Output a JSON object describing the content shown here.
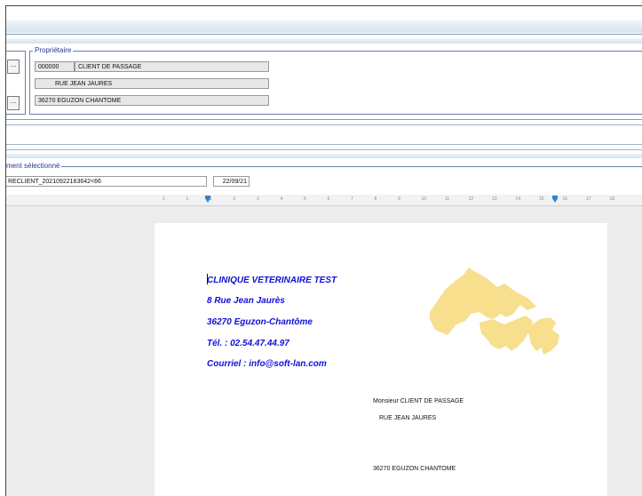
{
  "owner_section": {
    "title": "Propriétaire",
    "code": "000000",
    "name": "CLIENT DE PASSAGE",
    "street": "RUE JEAN JAURES",
    "city": "36270 EGUZON CHANTOME"
  },
  "buttons": {
    "ellipsis": "..."
  },
  "document_section": {
    "title": "ment sélectionné",
    "filename": "RECLIENT_20210922163642<66",
    "date": "22/09/21"
  },
  "ruler": {
    "ticks": [
      "2",
      "1",
      "1",
      "2",
      "3",
      "4",
      "5",
      "6",
      "7",
      "8",
      "9",
      "10",
      "11",
      "12",
      "13",
      "14",
      "15",
      "16",
      "17",
      "18"
    ]
  },
  "letter": {
    "clinic_name": "CLINIQUE VETERINAIRE TEST",
    "clinic_street": "8 Rue Jean Jaurès",
    "clinic_city": "36270 Eguzon-Chantôme",
    "clinic_phone": "Tél. : 02.54.47.44.97",
    "clinic_email": "Courriel : info@soft-lan.com",
    "recipient_name": "Monsieur CLIENT DE PASSAGE",
    "recipient_street": "RUE JEAN JAURES",
    "recipient_city": "36270 EGUZON CHANTOME"
  },
  "colors": {
    "clinic_text": "#1010d8",
    "logo": "#f7df8e",
    "frame_border": "#6d7fa6"
  }
}
